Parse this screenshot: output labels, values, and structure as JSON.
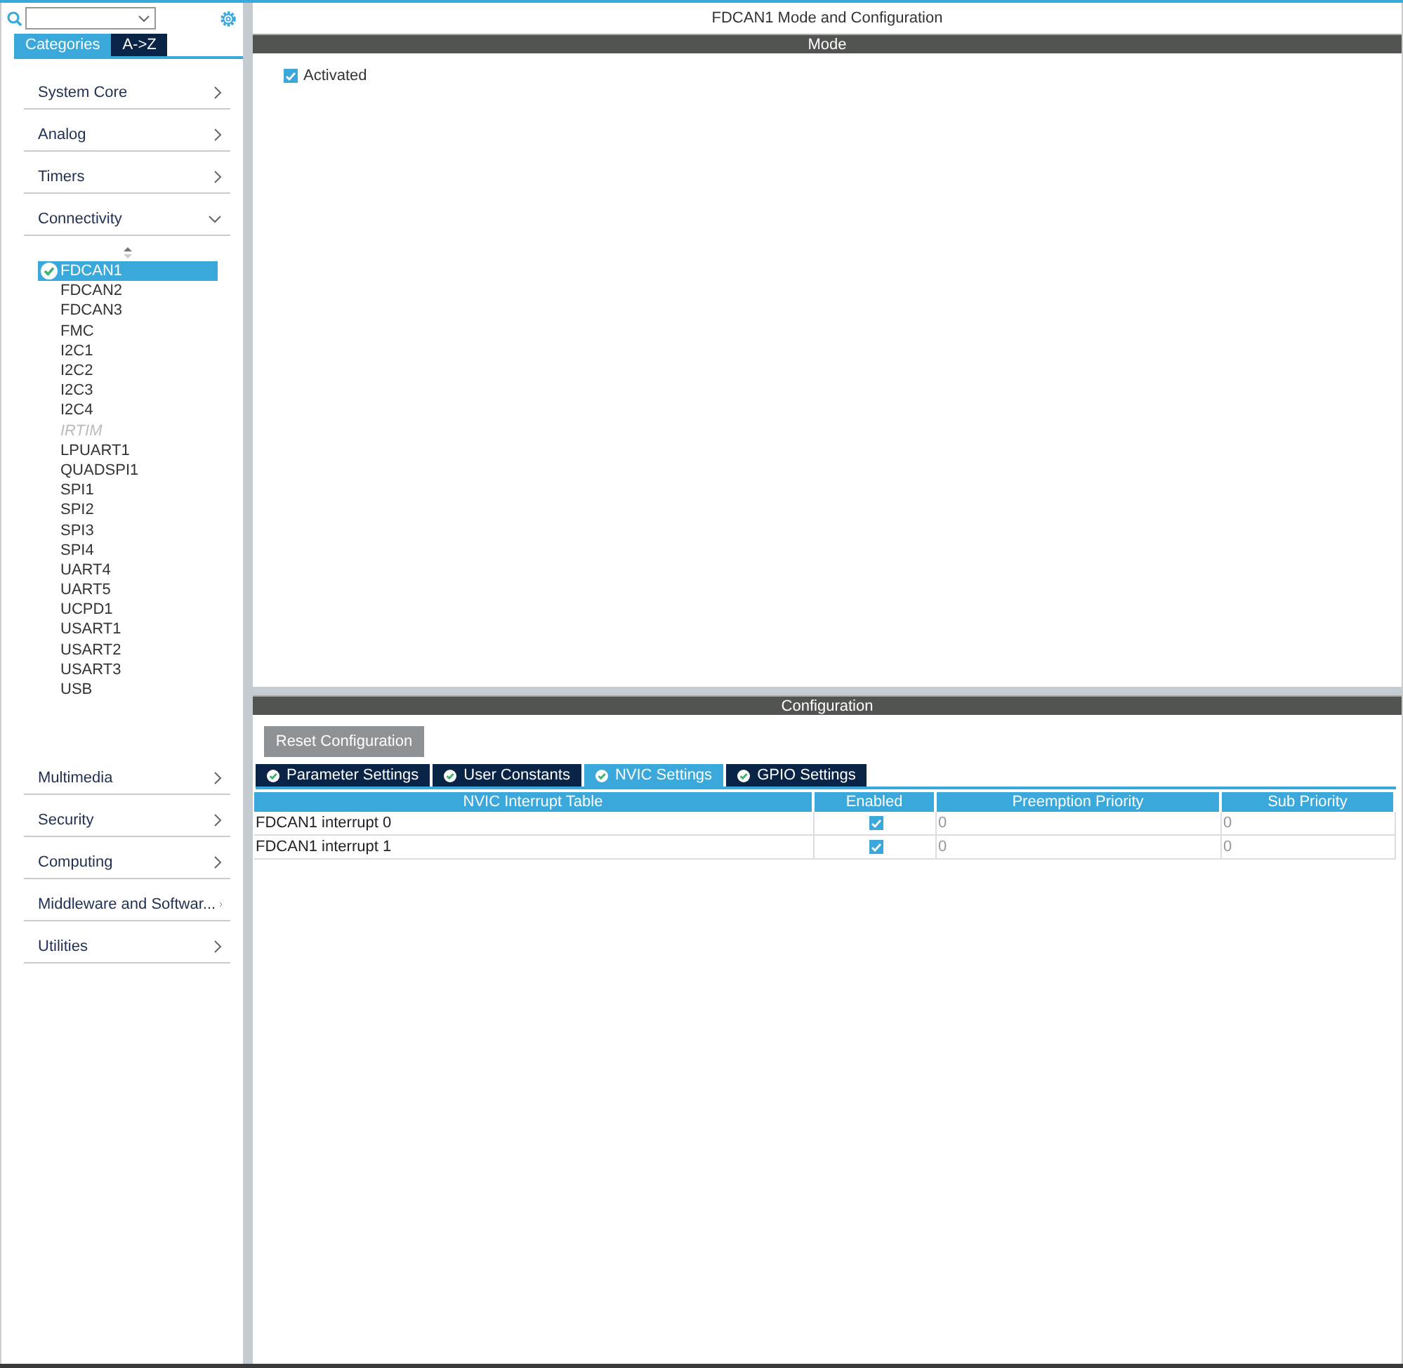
{
  "sidebar": {
    "tabs": [
      {
        "label": "Categories",
        "selected": true
      },
      {
        "label": "A->Z",
        "selected": false
      }
    ],
    "categories": [
      {
        "label": "System Core",
        "expanded": false
      },
      {
        "label": "Analog",
        "expanded": false
      },
      {
        "label": "Timers",
        "expanded": false
      },
      {
        "label": "Connectivity",
        "expanded": true,
        "items": [
          {
            "label": "FDCAN1",
            "selected": true,
            "configured": true,
            "disabled": false
          },
          {
            "label": "FDCAN2",
            "selected": false,
            "configured": false,
            "disabled": false
          },
          {
            "label": "FDCAN3",
            "selected": false,
            "configured": false,
            "disabled": false
          },
          {
            "label": "FMC",
            "selected": false,
            "configured": false,
            "disabled": false
          },
          {
            "label": "I2C1",
            "selected": false,
            "configured": false,
            "disabled": false
          },
          {
            "label": "I2C2",
            "selected": false,
            "configured": false,
            "disabled": false
          },
          {
            "label": "I2C3",
            "selected": false,
            "configured": false,
            "disabled": false
          },
          {
            "label": "I2C4",
            "selected": false,
            "configured": false,
            "disabled": false
          },
          {
            "label": "IRTIM",
            "selected": false,
            "configured": false,
            "disabled": true
          },
          {
            "label": "LPUART1",
            "selected": false,
            "configured": false,
            "disabled": false
          },
          {
            "label": "QUADSPI1",
            "selected": false,
            "configured": false,
            "disabled": false
          },
          {
            "label": "SPI1",
            "selected": false,
            "configured": false,
            "disabled": false
          },
          {
            "label": "SPI2",
            "selected": false,
            "configured": false,
            "disabled": false
          },
          {
            "label": "SPI3",
            "selected": false,
            "configured": false,
            "disabled": false
          },
          {
            "label": "SPI4",
            "selected": false,
            "configured": false,
            "disabled": false
          },
          {
            "label": "UART4",
            "selected": false,
            "configured": false,
            "disabled": false
          },
          {
            "label": "UART5",
            "selected": false,
            "configured": false,
            "disabled": false
          },
          {
            "label": "UCPD1",
            "selected": false,
            "configured": false,
            "disabled": false
          },
          {
            "label": "USART1",
            "selected": false,
            "configured": false,
            "disabled": false
          },
          {
            "label": "USART2",
            "selected": false,
            "configured": false,
            "disabled": false
          },
          {
            "label": "USART3",
            "selected": false,
            "configured": false,
            "disabled": false
          },
          {
            "label": "USB",
            "selected": false,
            "configured": false,
            "disabled": false
          }
        ]
      },
      {
        "label": "Multimedia",
        "expanded": false
      },
      {
        "label": "Security",
        "expanded": false
      },
      {
        "label": "Computing",
        "expanded": false
      },
      {
        "label": "Middleware and Softwar...",
        "expanded": false
      },
      {
        "label": "Utilities",
        "expanded": false
      }
    ]
  },
  "main": {
    "title": "FDCAN1 Mode and Configuration",
    "mode": {
      "header": "Mode",
      "activated": {
        "label": "Activated",
        "checked": true
      }
    },
    "configuration": {
      "header": "Configuration",
      "reset_button": "Reset Configuration",
      "tabs": [
        {
          "label": "Parameter Settings",
          "selected": false
        },
        {
          "label": "User Constants",
          "selected": false
        },
        {
          "label": "NVIC Settings",
          "selected": true
        },
        {
          "label": "GPIO Settings",
          "selected": false
        }
      ],
      "table": {
        "columns": [
          "NVIC Interrupt Table",
          "Enabled",
          "Preemption Priority",
          "Sub Priority"
        ],
        "rows": [
          {
            "name": "FDCAN1 interrupt 0",
            "enabled": true,
            "preemption": "0",
            "sub": "0"
          },
          {
            "name": "FDCAN1 interrupt 1",
            "enabled": true,
            "preemption": "0",
            "sub": "0"
          }
        ]
      }
    }
  }
}
